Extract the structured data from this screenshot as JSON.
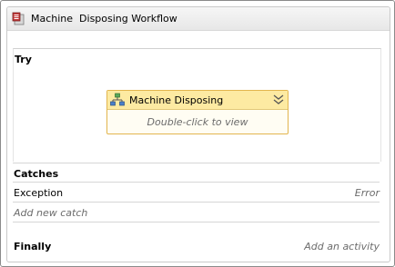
{
  "workflow": {
    "title": "Machine  Disposing Workflow",
    "icon": "try-catch-activity-icon"
  },
  "try_section": {
    "label": "Try",
    "activity": {
      "title": "Machine Disposing",
      "icon": "flowchart-icon",
      "hint": "Double-click to view"
    }
  },
  "catches_section": {
    "label": "Catches",
    "items": [
      {
        "exception": "Exception",
        "handler": "Error"
      }
    ],
    "add_new": "Add new catch"
  },
  "finally_section": {
    "label": "Finally",
    "add_activity": "Add an activity"
  },
  "colors": {
    "activity_header": "#fdeaa2",
    "activity_border": "#e2b54e",
    "hint_text": "#6b6b6b"
  }
}
